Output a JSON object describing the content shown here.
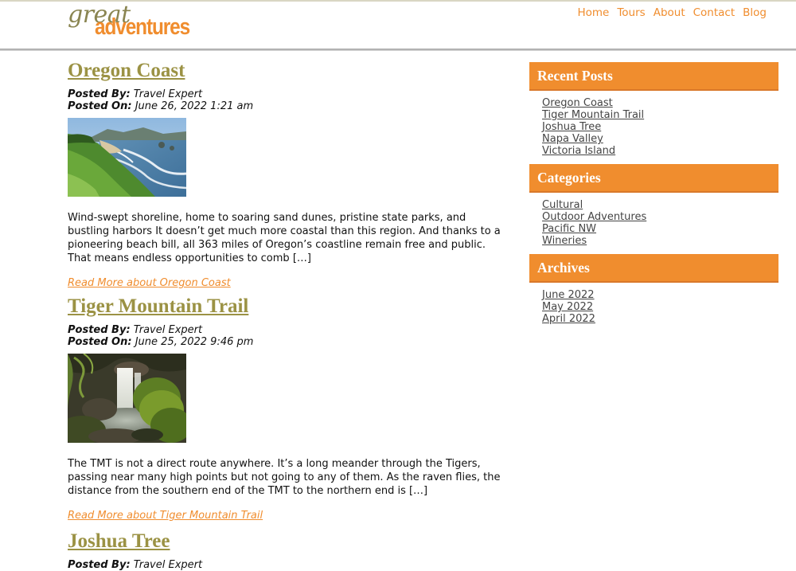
{
  "logo": {
    "line1": "great",
    "line2": "adventures"
  },
  "nav": [
    "Home",
    "Tours",
    "About",
    "Contact",
    "Blog"
  ],
  "labels": {
    "posted_by": "Posted By:",
    "posted_on": "Posted On:"
  },
  "posts": [
    {
      "title": "Oregon Coast",
      "author": "Travel Expert",
      "date": "June 26, 2022 1:21 am",
      "excerpt": "Wind-swept shoreline, home to soaring sand dunes, pristine state parks, and bustling harbors It doesn’t get much more coastal than this region. And thanks to a pioneering beach bill, all 363 miles of Oregon’s coastline remain free and public. That means endless opportunities to comb […]",
      "read_more": "Read More about Oregon Coast"
    },
    {
      "title": "Tiger Mountain Trail",
      "author": "Travel Expert",
      "date": "June 25, 2022 9:46 pm",
      "excerpt": "The TMT is not a direct route anywhere. It’s a long meander through the Tigers, passing near many high points but not going to any of them. As the raven flies, the distance from the southern end of the TMT to the northern end is […]",
      "read_more": "Read More about Tiger Mountain Trail"
    },
    {
      "title": "Joshua Tree",
      "author": "Travel Expert"
    }
  ],
  "sidebar": {
    "recent": {
      "title": "Recent Posts",
      "items": [
        "Oregon Coast",
        "Tiger Mountain Trail",
        "Joshua Tree",
        "Napa Valley",
        "Victoria Island"
      ]
    },
    "categories": {
      "title": "Categories",
      "items": [
        "Cultural",
        "Outdoor Adventures",
        "Pacific NW",
        "Wineries"
      ]
    },
    "archives": {
      "title": "Archives",
      "items": [
        "June 2022",
        "May 2022",
        "April 2022"
      ]
    }
  },
  "colors": {
    "accent": "#f08d2e",
    "title_olive": "#9b9244"
  }
}
